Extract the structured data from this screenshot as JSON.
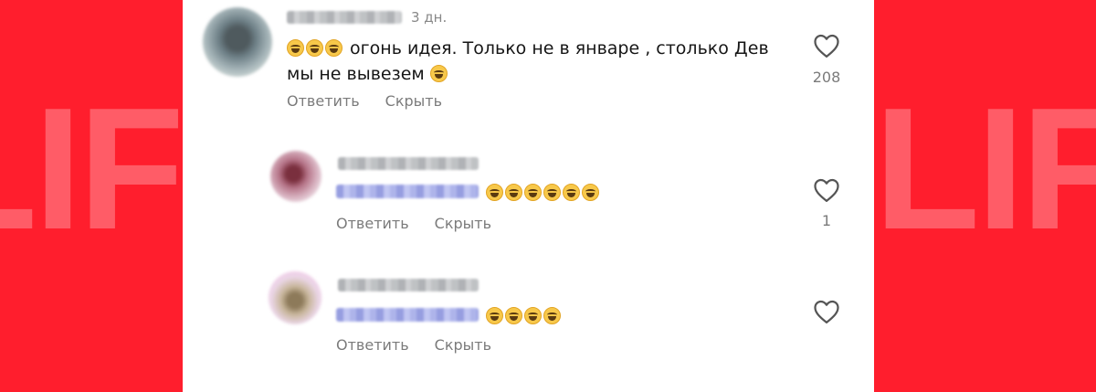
{
  "watermark": {
    "left": "LIFE",
    "right": "LIFE"
  },
  "comments": [
    {
      "time": "3 дн.",
      "line1": "огонь идея. Только не в январе , столько Дев",
      "line2": "мы не вывезем",
      "leading_emoji_count": 3,
      "trailing_emoji_count": 1,
      "reply_label": "Ответить",
      "hide_label": "Скрыть",
      "likes": "208"
    },
    {
      "emoji_count": 6,
      "reply_label": "Ответить",
      "hide_label": "Скрыть",
      "likes": "1"
    },
    {
      "emoji_count": 4,
      "reply_label": "Ответить",
      "hide_label": "Скрыть",
      "likes": ""
    }
  ],
  "colors": {
    "background": "#ff1e2d",
    "card": "#ffffff",
    "secondary_text": "#7b7b7b"
  },
  "icons": {
    "like": "heart-outline-icon",
    "emoji": "laughing-face-icon"
  }
}
